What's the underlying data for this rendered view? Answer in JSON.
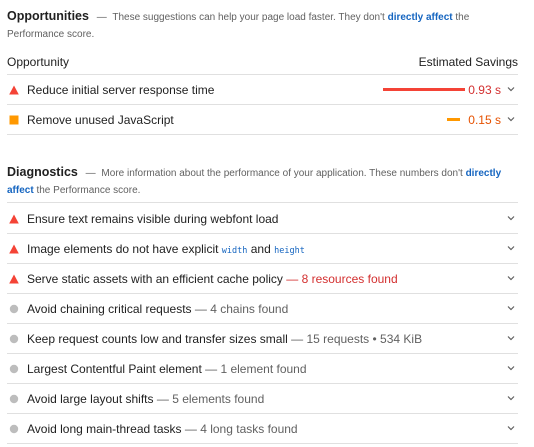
{
  "opportunities": {
    "title": "Opportunities",
    "dash": "—",
    "desc_before": "These suggestions can help your page load faster. They don't",
    "desc_link": "directly affect",
    "desc_after": "the Performance score.",
    "col_left": "Opportunity",
    "col_right": "Estimated Savings",
    "items": [
      {
        "label": "Reduce initial server response time",
        "savings": "0.93 s",
        "savings_fraction": 1.0,
        "status": "fail",
        "color": "#f44336"
      },
      {
        "label": "Remove unused JavaScript",
        "savings": "0.15 s",
        "savings_fraction": 0.16,
        "status": "average",
        "color": "#ff9800"
      }
    ]
  },
  "diagnostics": {
    "title": "Diagnostics",
    "dash": "—",
    "desc_before": "More information about the performance of your application. These numbers don't",
    "desc_link": "directly affect",
    "desc_after": "the Performance score.",
    "items": [
      {
        "label": "Ensure text remains visible during webfont load",
        "detail": "",
        "status": "fail"
      },
      {
        "label": "Image elements do not have explicit",
        "code1": "width",
        "and": "and",
        "code2": "height",
        "detail": "",
        "status": "fail"
      },
      {
        "label": "Serve static assets with an efficient cache policy",
        "detail": "— 8 resources found",
        "status": "fail"
      },
      {
        "label": "Avoid chaining critical requests",
        "detail": "— 4 chains found",
        "status": "info"
      },
      {
        "label": "Keep request counts low and transfer sizes small",
        "detail": "— 15 requests • 534 KiB",
        "status": "info"
      },
      {
        "label": "Largest Contentful Paint element",
        "detail": "— 1 element found",
        "status": "info"
      },
      {
        "label": "Avoid large layout shifts",
        "detail": "— 5 elements found",
        "status": "info"
      },
      {
        "label": "Avoid long main-thread tasks",
        "detail": "— 4 long tasks found",
        "status": "info"
      }
    ]
  },
  "colors": {
    "fail": "#f44336",
    "average": "#ff9800",
    "info": "#bdbdbd",
    "link": "#1565c0",
    "fail_text": "#d32f2f"
  },
  "icons": {
    "fail": "triangle-icon",
    "average": "square-icon",
    "info": "circle-icon",
    "expand": "chevron-down-icon"
  }
}
